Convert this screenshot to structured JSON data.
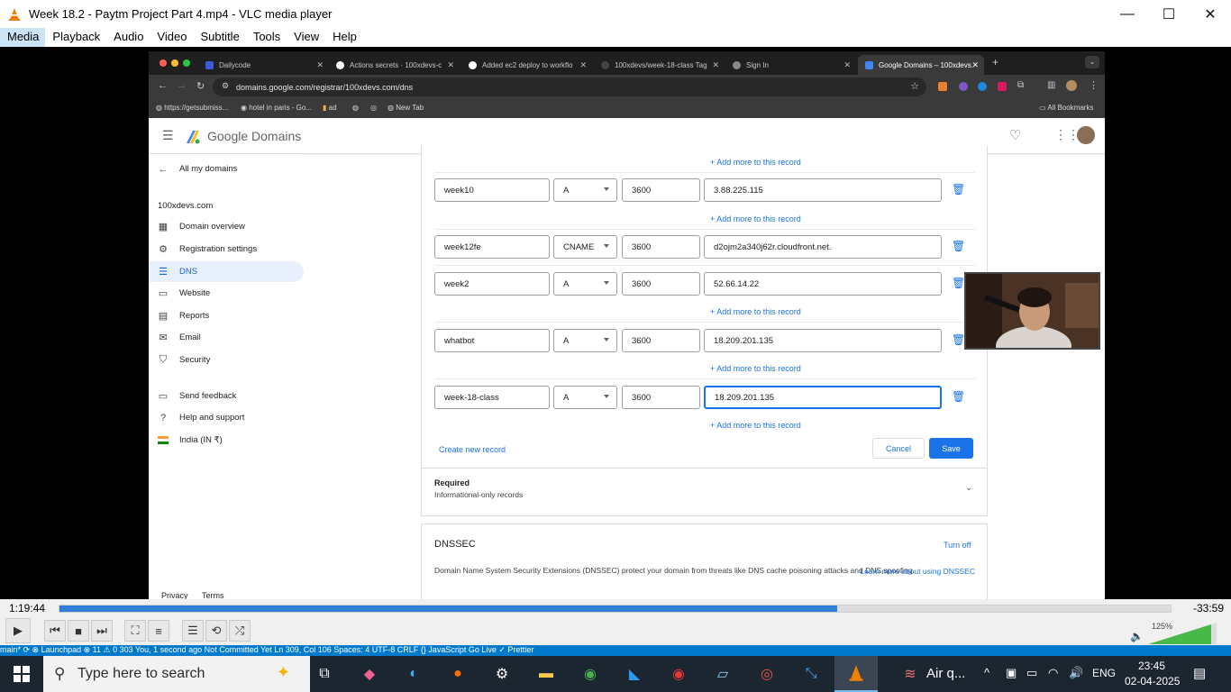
{
  "vlc": {
    "title": "Week 18.2 - Paytm Project Part 4.mp4 - VLC media player",
    "menu": [
      "Media",
      "Playback",
      "Audio",
      "Video",
      "Subtitle",
      "Tools",
      "View",
      "Help"
    ],
    "elapsed": "1:19:44",
    "remaining": "-33:59",
    "progress": 0.7,
    "volume": "125%"
  },
  "browser": {
    "tabs": [
      {
        "label": "Dailycode",
        "color": "#3b5bdb"
      },
      {
        "label": "Actions secrets · 100xdevs-c",
        "color": "#ffffff"
      },
      {
        "label": "Added ec2 deploy to workflo",
        "color": "#ffffff"
      },
      {
        "label": "100xdevs/week-18-class Tag",
        "color": "#444444"
      },
      {
        "label": "Sign In",
        "color": "#888888"
      },
      {
        "label": "Google Domains – 100xdevs.",
        "color": "#4285f4"
      }
    ],
    "url": "domains.google.com/registrar/100xdevs.com/dns",
    "bookmarks": [
      "https://getsubmiss...",
      "hotel in paris - Go...",
      "ad",
      "",
      "",
      "New Tab"
    ],
    "all_bookmarks": "All Bookmarks"
  },
  "gd": {
    "brand": "Google Domains",
    "back": "All my domains",
    "domain": "100xdevs.com",
    "nav": [
      {
        "label": "Domain overview",
        "icon": "grid-icon"
      },
      {
        "label": "Registration settings",
        "icon": "gear-icon"
      },
      {
        "label": "DNS",
        "icon": "dns-icon"
      },
      {
        "label": "Website",
        "icon": "web-icon"
      },
      {
        "label": "Reports",
        "icon": "reports-icon"
      },
      {
        "label": "Email",
        "icon": "mail-icon"
      },
      {
        "label": "Security",
        "icon": "shield-icon"
      }
    ],
    "nav2": [
      {
        "label": "Send feedback",
        "icon": "feedback-icon"
      },
      {
        "label": "Help and support",
        "icon": "help-icon"
      },
      {
        "label": "India (IN ₹)",
        "icon": "flag-icon"
      }
    ],
    "footer": {
      "privacy": "Privacy",
      "terms": "Terms"
    },
    "add_more": "Add more to this record",
    "records": [
      {
        "name": "week10",
        "type": "A",
        "ttl": "3600",
        "data": "3.88.225.115"
      },
      {
        "name": "week12fe",
        "type": "CNAME",
        "ttl": "3600",
        "data": "d2ojm2a340j62r.cloudfront.net."
      },
      {
        "name": "week2",
        "type": "A",
        "ttl": "3600",
        "data": "52.66.14.22"
      },
      {
        "name": "whatbot",
        "type": "A",
        "ttl": "3600",
        "data": "18.209.201.135"
      },
      {
        "name": "week-18-class",
        "type": "A",
        "ttl": "3600",
        "data": "18.209.201.135"
      }
    ],
    "create_new": "Create new record",
    "cancel": "Cancel",
    "save": "Save",
    "required_title": "Required",
    "required_sub": "Informational-only records",
    "dnssec_title": "DNSSEC",
    "dnssec_turnoff": "Turn off",
    "dnssec_desc": "Domain Name System Security Extensions (DNSSEC) protect your domain from threats like DNS cache poisoning attacks and DNS spoofing.",
    "dnssec_learn": "Learn more about using DNSSEC"
  },
  "vscode_strip": "main*  ⟳  ⊗  Launchpad  ⊗ 11 ⚠ 0  303          You, 1 second ago    Not Committed Yet    Ln 309, Col 106   Spaces: 4   UTF-8   CRLF   {} JavaScript   Go Live   ✓ Prettier",
  "taskbar": {
    "search_placeholder": "Type here to search",
    "weather": "Air q...",
    "lang": "ENG",
    "time": "23:45",
    "date": "02-04-2025"
  },
  "colors": {
    "accent": "#1a73e8",
    "vlc_progress": "#2f7ed8",
    "taskbar": "#1c2630"
  }
}
